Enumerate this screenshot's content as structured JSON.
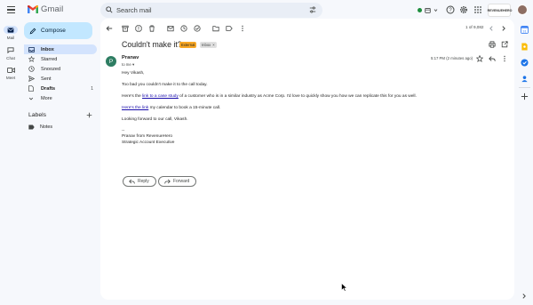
{
  "app": {
    "name": "Gmail"
  },
  "search": {
    "placeholder": "Search mail"
  },
  "rail": [
    {
      "label": "Mail",
      "icon": "mail-icon",
      "active": true
    },
    {
      "label": "Chat",
      "icon": "chat-icon",
      "active": false
    },
    {
      "label": "Meet",
      "icon": "video-icon",
      "active": false
    }
  ],
  "sidebar": {
    "compose_label": "Compose",
    "items": [
      {
        "label": "Inbox",
        "icon": "inbox-icon",
        "count": ""
      },
      {
        "label": "Starred",
        "icon": "star-icon",
        "count": ""
      },
      {
        "label": "Snoozed",
        "icon": "clock-icon",
        "count": ""
      },
      {
        "label": "Sent",
        "icon": "send-icon",
        "count": ""
      },
      {
        "label": "Drafts",
        "icon": "draft-icon",
        "count": "1"
      },
      {
        "label": "More",
        "icon": "chevron-down-icon",
        "count": ""
      }
    ],
    "labels_heading": "Labels",
    "labels": [
      {
        "label": "Notes",
        "icon": "label-icon"
      }
    ]
  },
  "header": {
    "brand_badge": "REVENUEHERO"
  },
  "email": {
    "pager": "1 of 9,082",
    "subject": "Couldn't make it?",
    "chips": {
      "external": "External",
      "inbox": "Inbox"
    },
    "sender": {
      "name": "Pranav",
      "initial": "P",
      "to": "to me"
    },
    "timestamp": "5:17 PM (2 minutes ago)",
    "body": {
      "greeting": "Hey Vikash,",
      "line1": "Too bad you couldn't make it to the call today.",
      "line2_pre": "Here's the ",
      "line2_link": "link to a case study",
      "line2_post": " of a customer who is in a similar industry as Acme Corp. I'd love to quickly show you how we can replicate this for you as well.",
      "line3_link": "Here's the link",
      "line3_post": " my calendar to book a 15-minute call.",
      "line4": "Looking forward to our call, Vikash.",
      "sig_sep": "--",
      "sig_name": "Pranav from RevenueHero",
      "sig_title": "Strategic Account Executive"
    },
    "actions": {
      "reply": "Reply",
      "forward": "Forward"
    }
  },
  "colors": {
    "accent": "#0b57d0",
    "compose_bg": "#c2e7ff",
    "active_nav": "#d3e3fd",
    "avatar": "#2e7d62",
    "external_chip": "#f9a825"
  }
}
